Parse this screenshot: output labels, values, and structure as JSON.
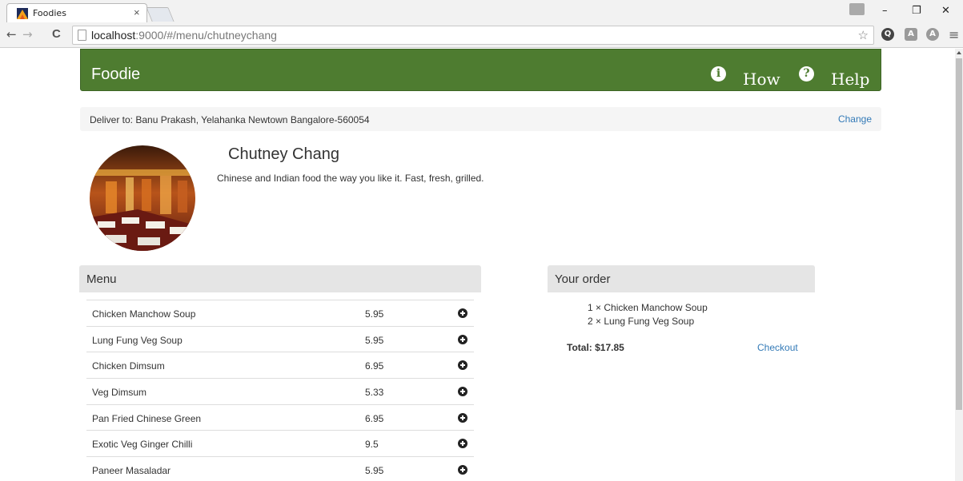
{
  "browser": {
    "tab_title": "Foodies",
    "tab_close": "×",
    "url_host": "localhost",
    "url_path": ":9000/#/menu/chutneychang",
    "window_controls": {
      "minimize": "–",
      "restore": "❐",
      "close": "✕"
    },
    "nav_icons": {
      "back": "←",
      "forward": "→",
      "reload": "C"
    },
    "icons": [
      "page-icon",
      "star-icon",
      "extension-icon",
      "menu-icon"
    ]
  },
  "header": {
    "brand": "Foodie",
    "nav": [
      {
        "label": "How",
        "icon": "info-icon",
        "glyph": "i"
      },
      {
        "label": "Help",
        "icon": "question-icon",
        "glyph": "?"
      }
    ],
    "color": "#4e7c30"
  },
  "delivery": {
    "text": "Deliver to: Banu Prakash, Yelahanka Newtown Bangalore-560054",
    "change_label": "Change"
  },
  "restaurant": {
    "name": "Chutney Chang",
    "description": "Chinese and Indian food the way you like it. Fast, fresh, grilled."
  },
  "menu": {
    "title": "Menu",
    "items": [
      {
        "name": "Chicken Manchow Soup",
        "price": "5.95"
      },
      {
        "name": "Lung Fung Veg Soup",
        "price": "5.95"
      },
      {
        "name": "Chicken Dimsum",
        "price": "6.95"
      },
      {
        "name": "Veg Dimsum",
        "price": "5.33"
      },
      {
        "name": "Pan Fried Chinese Green",
        "price": "6.95"
      },
      {
        "name": "Exotic Veg Ginger Chilli",
        "price": "9.5"
      },
      {
        "name": "Paneer Masaladar",
        "price": "5.95"
      }
    ]
  },
  "order": {
    "title": "Your order",
    "lines": [
      "1 × Chicken Manchow Soup",
      "2 × Lung Fung Veg Soup"
    ],
    "total": "Total: $17.85",
    "checkout_label": "Checkout"
  }
}
